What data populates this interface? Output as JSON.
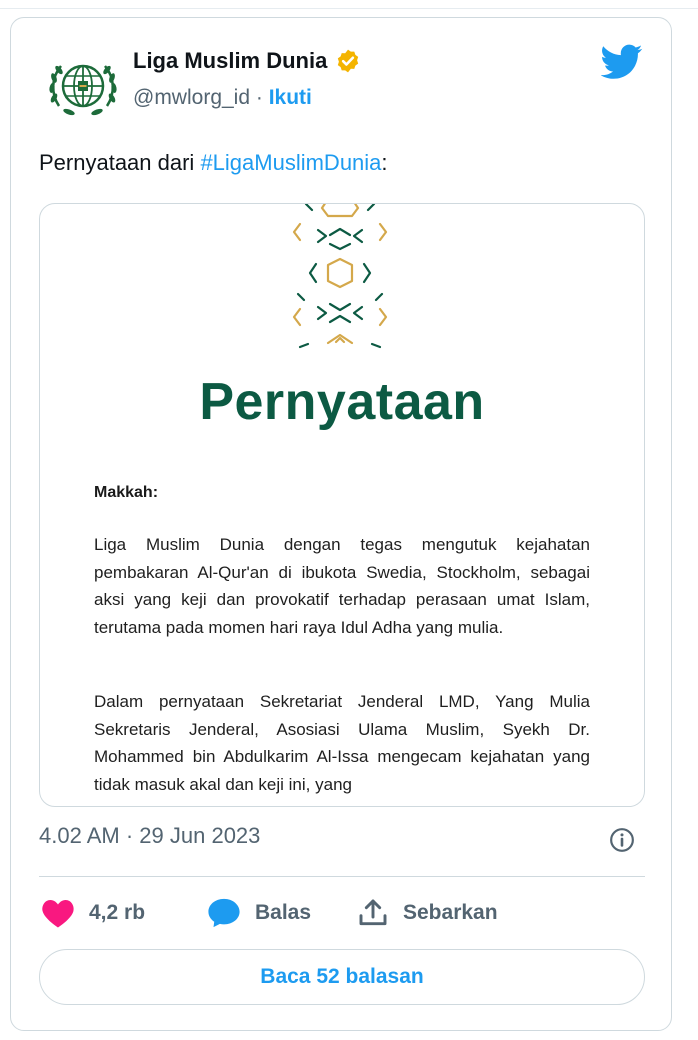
{
  "author": {
    "name": "Liga Muslim Dunia",
    "handle": "@mwlorg_id",
    "separator": "·",
    "follow_label": "Ikuti",
    "verified_color": "#f4b400"
  },
  "tweet": {
    "text_prefix": "Pernyataan dari ",
    "hashtag": "#LigaMuslimDunia",
    "text_suffix": ":"
  },
  "media": {
    "title": "Pernyataan",
    "location": "Makkah:",
    "paragraph1": "Liga Muslim Dunia dengan tegas mengutuk kejahatan pembakaran Al-Qur'an di ibukota Swedia, Stockholm, sebagai aksi yang keji dan provokatif terhadap perasaan umat Islam, terutama pada momen hari raya Idul Adha yang mulia.",
    "paragraph2": "Dalam pernyataan Sekretariat Jenderal LMD, Yang Mulia Sekretaris Jenderal, Asosiasi Ulama Muslim, Syekh Dr. Mohammed bin Abdulkarim Al-Issa mengecam kejahatan yang tidak masuk akal dan keji ini, yang",
    "title_color": "#0c5a43",
    "pattern_colors": [
      "#d4a84b",
      "#0c5a43"
    ]
  },
  "meta": {
    "time": "4.02 AM",
    "separator": "·",
    "date": "29 Jun 2023"
  },
  "actions": {
    "like_count": "4,2 rb",
    "reply_label": "Balas",
    "share_label": "Sebarkan"
  },
  "read_replies_label": "Baca 52 balasan",
  "colors": {
    "accent": "#1d9bf0",
    "like": "#f91880",
    "muted": "#536471",
    "border": "#cfd9de"
  },
  "icons": {
    "brand": "twitter-bird-icon",
    "verified": "verified-badge-icon",
    "info": "info-icon",
    "like": "heart-icon",
    "reply": "speech-bubble-icon",
    "share": "share-upload-icon"
  }
}
